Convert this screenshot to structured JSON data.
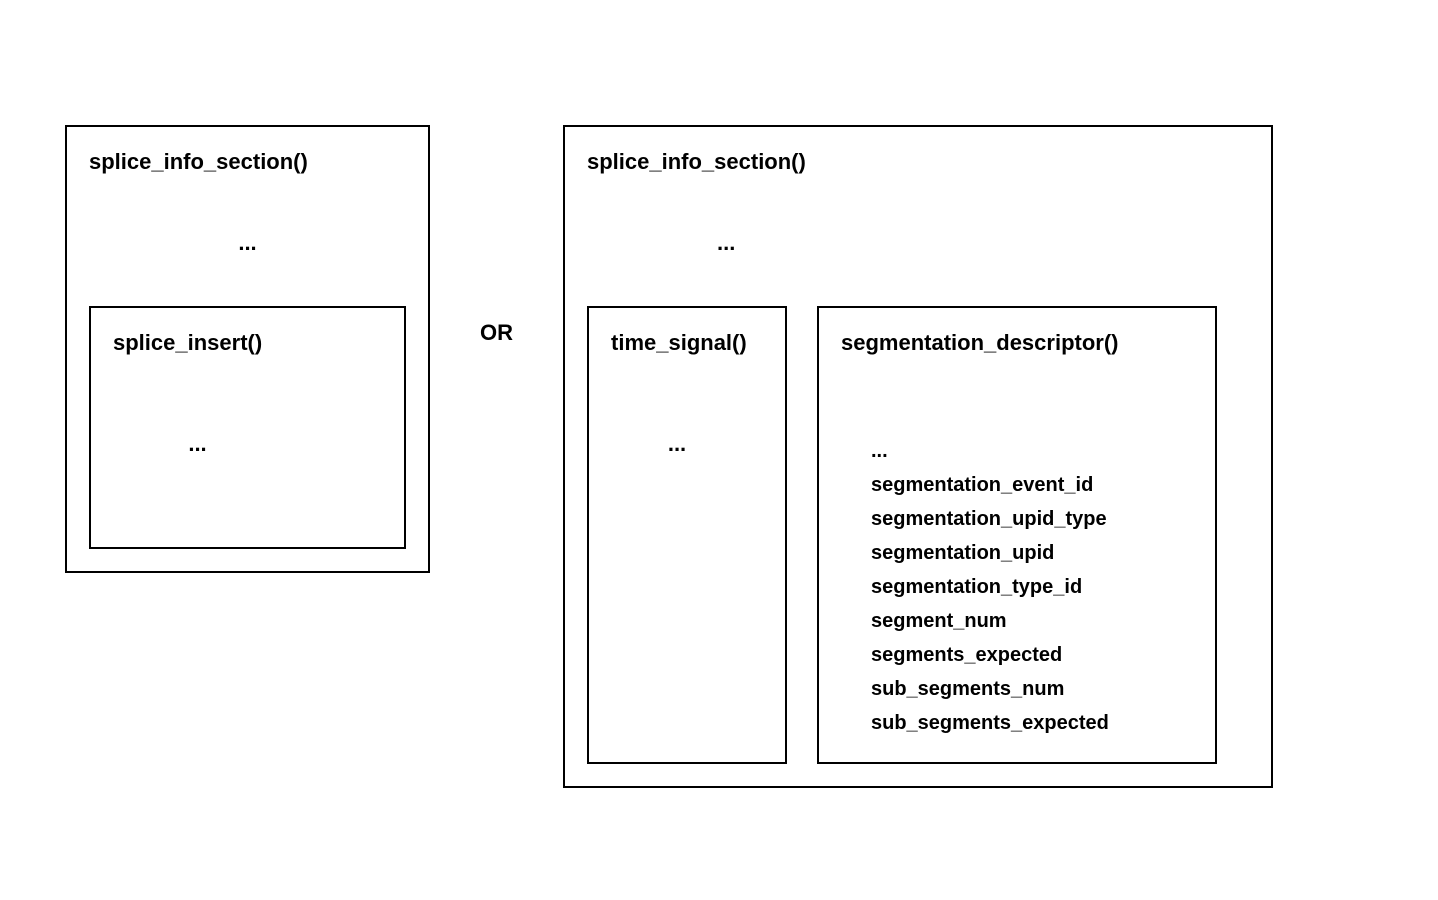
{
  "left": {
    "title": "splice_info_section()",
    "ellipsis": "...",
    "inner": {
      "title": "splice_insert()",
      "ellipsis": "..."
    }
  },
  "separator": "OR",
  "right": {
    "title": "splice_info_section()",
    "ellipsis": "...",
    "timeSignal": {
      "title": "time_signal()",
      "ellipsis": "..."
    },
    "segDescriptor": {
      "title": "segmentation_descriptor()",
      "fields": {
        "f0": "...",
        "f1": "segmentation_event_id",
        "f2": "segmentation_upid_type",
        "f3": "segmentation_upid",
        "f4": "segmentation_type_id",
        "f5": "segment_num",
        "f6": "segments_expected",
        "f7": "sub_segments_num",
        "f8": "sub_segments_expected"
      }
    }
  }
}
